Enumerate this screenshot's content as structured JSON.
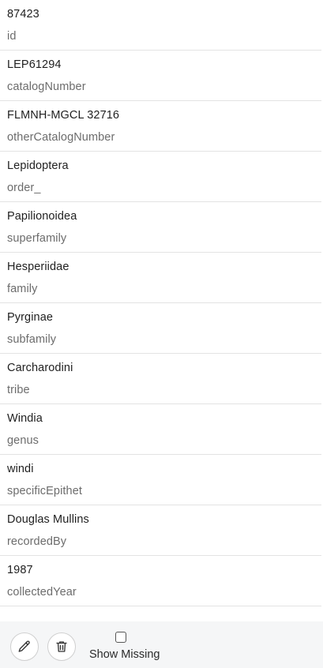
{
  "fields": [
    {
      "value": "87423",
      "key": "id"
    },
    {
      "value": "LEP61294",
      "key": "catalogNumber"
    },
    {
      "value": "FLMNH-MGCL 32716",
      "key": "otherCatalogNumber"
    },
    {
      "value": "Lepidoptera",
      "key": "order_"
    },
    {
      "value": "Papilionoidea",
      "key": "superfamily"
    },
    {
      "value": "Hesperiidae",
      "key": "family"
    },
    {
      "value": "Pyrginae",
      "key": "subfamily"
    },
    {
      "value": "Carcharodini",
      "key": "tribe"
    },
    {
      "value": "Windia",
      "key": "genus"
    },
    {
      "value": "windi",
      "key": "specificEpithet"
    },
    {
      "value": "Douglas Mullins",
      "key": "recordedBy"
    },
    {
      "value": "1987",
      "key": "collectedYear"
    }
  ],
  "footer": {
    "edit_icon": "pencil-icon",
    "delete_icon": "trash-icon",
    "show_missing_label": "Show Missing",
    "show_missing_checked": false
  }
}
